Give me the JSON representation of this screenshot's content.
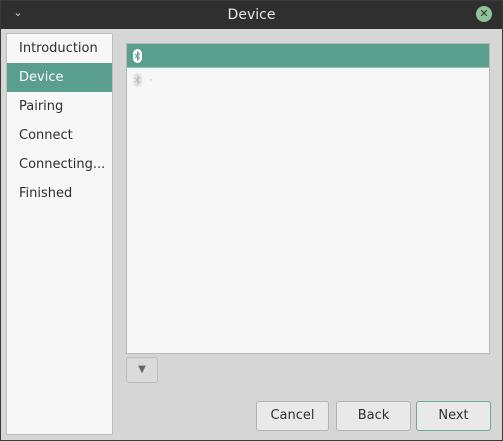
{
  "window": {
    "title": "Device",
    "menu_icon": "chevron-down-icon",
    "close_icon": "close-icon",
    "close_glyph": "✕"
  },
  "sidebar": {
    "items": [
      {
        "label": "Introduction"
      },
      {
        "label": "Device"
      },
      {
        "label": "Pairing"
      },
      {
        "label": "Connect"
      },
      {
        "label": "Connecting..."
      },
      {
        "label": "Finished"
      }
    ],
    "active_index": 1
  },
  "device_list": {
    "rows": [
      {
        "icon": "bluetooth-icon",
        "name": "",
        "selected": true
      },
      {
        "icon": "bluetooth-icon",
        "name": "·",
        "selected": false
      }
    ]
  },
  "buttons": {
    "expander_icon": "chevron-down-icon",
    "cancel": "Cancel",
    "back": "Back",
    "next": "Next"
  },
  "colors": {
    "accent": "#5a9e8e",
    "titlebar": "#2f2f2f",
    "close_button": "#8fc49a"
  }
}
